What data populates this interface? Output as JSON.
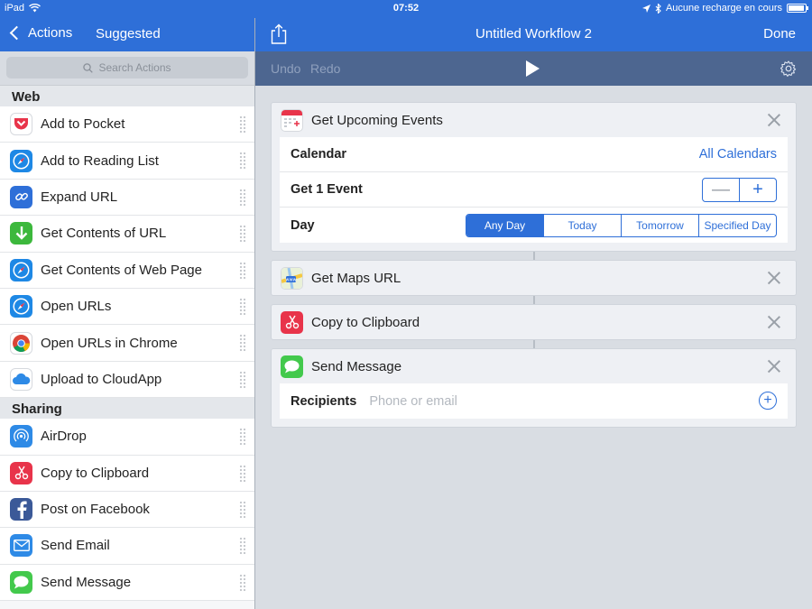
{
  "status_bar": {
    "device": "iPad",
    "time": "07:52",
    "battery_text": "Aucune recharge en cours",
    "battery_level": 0.95
  },
  "sidebar": {
    "back_label": "Actions",
    "title": "Suggested",
    "search_placeholder": "Search Actions",
    "sections": [
      {
        "header": "Web",
        "items": [
          {
            "label": "Add to Pocket",
            "icon": "pocket-icon",
            "color": "#ffffff"
          },
          {
            "label": "Add to Reading List",
            "icon": "safari-icon",
            "color": "#1e88e5"
          },
          {
            "label": "Expand URL",
            "icon": "link-icon",
            "color": "#2e6fd8"
          },
          {
            "label": "Get Contents of URL",
            "icon": "download-icon",
            "color": "#3cb83c"
          },
          {
            "label": "Get Contents of Web Page",
            "icon": "safari-icon",
            "color": "#1e88e5"
          },
          {
            "label": "Open URLs",
            "icon": "safari-icon",
            "color": "#1e88e5"
          },
          {
            "label": "Open URLs in Chrome",
            "icon": "chrome-icon",
            "color": "#ffffff"
          },
          {
            "label": "Upload to CloudApp",
            "icon": "cloud-icon",
            "color": "#ffffff"
          }
        ]
      },
      {
        "header": "Sharing",
        "items": [
          {
            "label": "AirDrop",
            "icon": "airdrop-icon",
            "color": "#2e8ae6"
          },
          {
            "label": "Copy to Clipboard",
            "icon": "scissors-icon",
            "color": "#e8344a"
          },
          {
            "label": "Post on Facebook",
            "icon": "facebook-icon",
            "color": "#3b5998"
          },
          {
            "label": "Send Email",
            "icon": "mail-icon",
            "color": "#2e8ae6"
          },
          {
            "label": "Send Message",
            "icon": "message-icon",
            "color": "#43c94c"
          }
        ]
      }
    ]
  },
  "workflow": {
    "title": "Untitled Workflow 2",
    "done_label": "Done",
    "undo_label": "Undo",
    "redo_label": "Redo",
    "cards": {
      "events": {
        "title": "Get Upcoming Events",
        "calendar_label": "Calendar",
        "calendar_value": "All Calendars",
        "get_label": "Get 1 Event",
        "stepper_minus": "—",
        "stepper_plus": "+",
        "day_label": "Day",
        "day_options": [
          "Any Day",
          "Today",
          "Tomorrow",
          "Specified Day"
        ],
        "day_selected": "Any Day"
      },
      "maps": {
        "title": "Get Maps URL"
      },
      "clipboard": {
        "title": "Copy to Clipboard"
      },
      "message": {
        "title": "Send Message",
        "recipients_label": "Recipients",
        "recipients_placeholder": "Phone or email",
        "add_symbol": "+"
      }
    }
  }
}
